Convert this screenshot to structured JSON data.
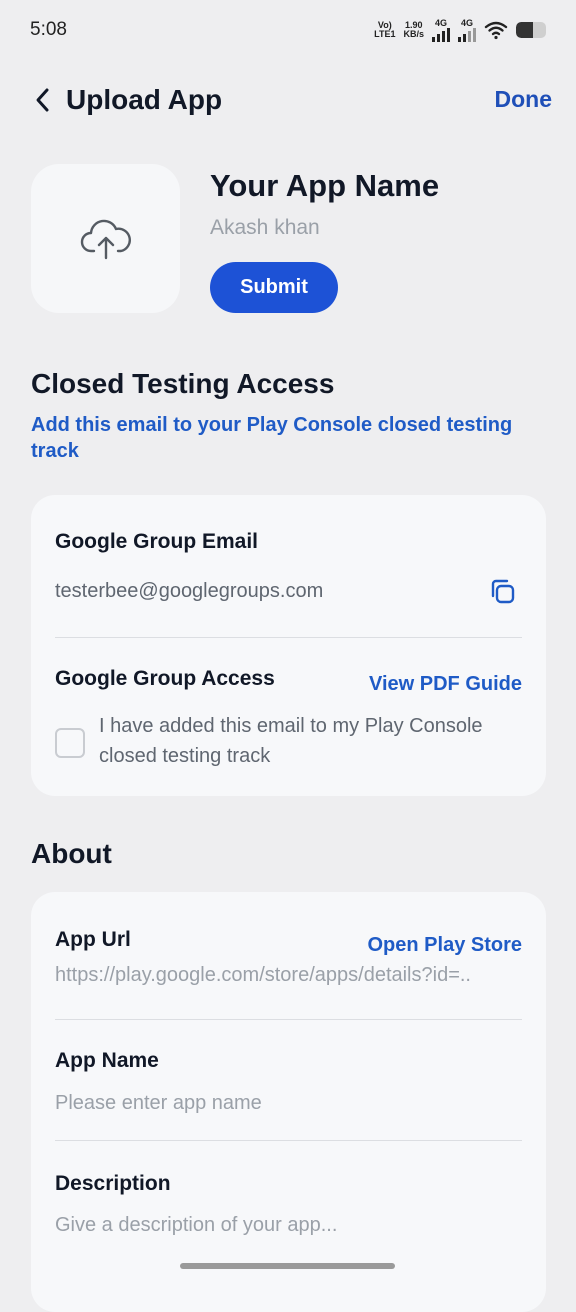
{
  "status_bar": {
    "time": "5:08",
    "volte": "Vo)",
    "lte": "LTE1",
    "speed_value": "1.90",
    "speed_unit": "KB/s",
    "net1": "4G",
    "net2": "4G"
  },
  "header": {
    "title": "Upload App",
    "done_label": "Done"
  },
  "app": {
    "name": "Your App Name",
    "author": "Akash khan",
    "submit_label": "Submit",
    "icon": "cloud-upload-icon"
  },
  "closed_testing": {
    "title": "Closed Testing Access",
    "subtitle": "Add this email to your Play Console closed testing track",
    "email_label": "Google Group Email",
    "email_value": "testerbee@googlegroups.com",
    "access_label": "Google Group Access",
    "guide_link": "View PDF Guide",
    "checkbox_label": "I have added this email to my Play Console closed testing track",
    "checkbox_checked": false
  },
  "about": {
    "title": "About",
    "app_url_label": "App Url",
    "app_url_link": "Open Play Store",
    "app_url_value": "https://play.google.com/store/apps/details?id=..",
    "app_name_label": "App Name",
    "app_name_placeholder": "Please enter app name",
    "description_label": "Description",
    "description_placeholder": "Give a description of your app..."
  },
  "colors": {
    "accent": "#1d52d6",
    "link": "#1f5bc6",
    "background": "#eeeef0",
    "card": "#f7f8fa"
  }
}
